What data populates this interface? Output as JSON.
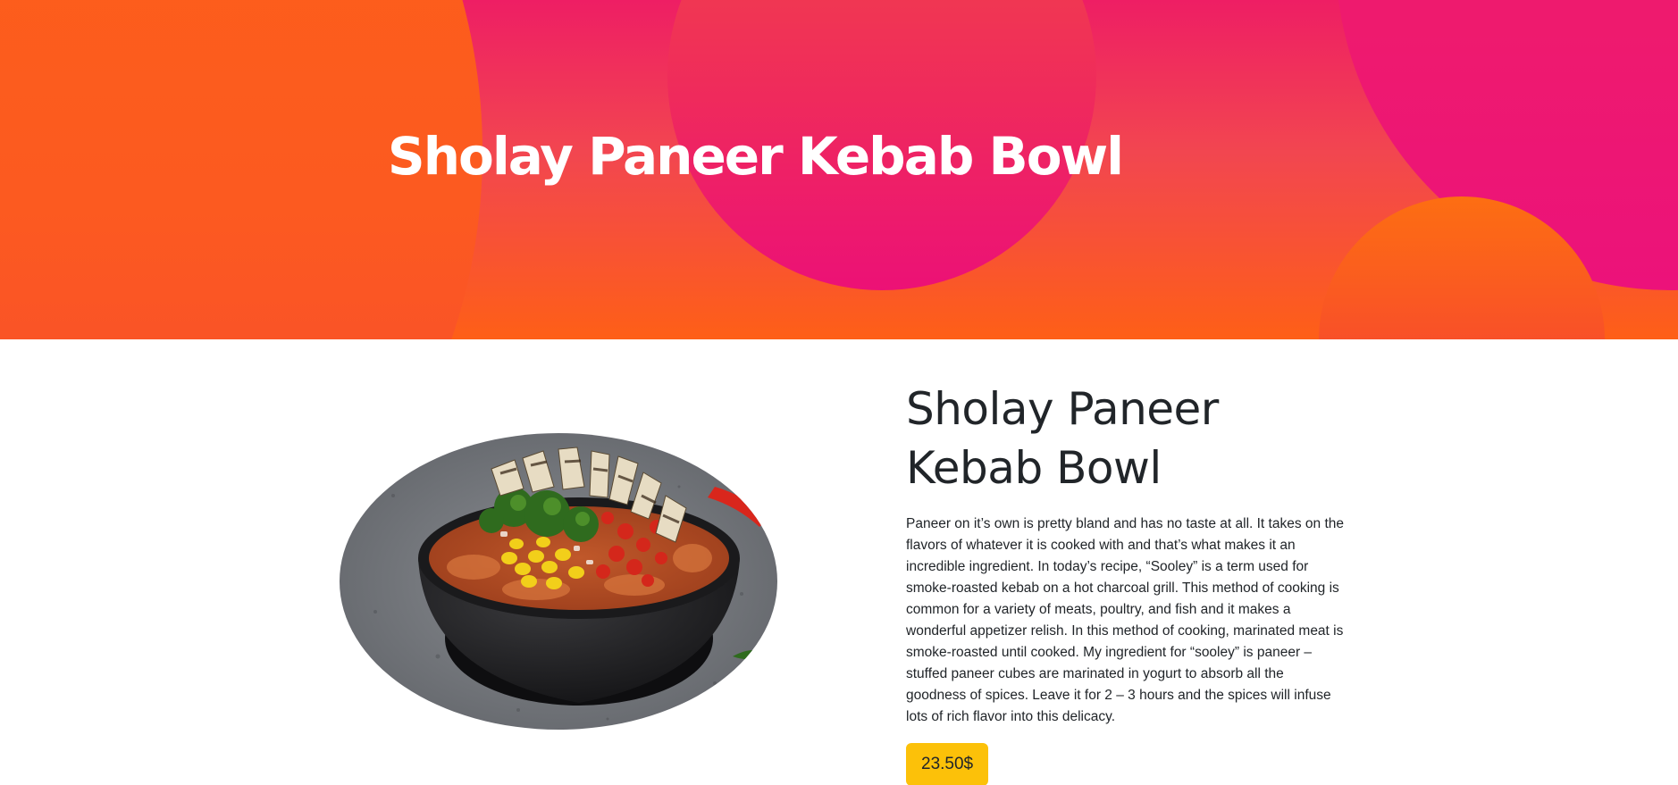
{
  "hero": {
    "title": "Sholay Paneer Kebab Bowl"
  },
  "recipe": {
    "title": "Sholay Paneer Kebab Bowl",
    "description": "Paneer on it’s own is pretty bland and has no taste at all. It takes on the flavors of whatever it is cooked with and that’s what makes it an incredible ingredient. In today’s recipe, “Sooley” is a term used for smoke-roasted kebab on a hot charcoal grill. This method of cooking is common for a variety of meats, poultry, and fish and it makes a wonderful appetizer relish. In this method of cooking, marinated meat is smoke-roasted until cooked. My ingredient for “sooley” is paneer – stuffed paneer cubes are marinated in yogurt to absorb all the goodness of spices. Leave it for 2 – 3 hours and the spices will infuse lots of rich flavor into this delicacy.",
    "price": "23.50$",
    "image_icon": "food-bowl-photo"
  },
  "colors": {
    "hero_orange": "#fe6215",
    "hero_pink": "#ec1176",
    "price_badge": "#fcc109",
    "text": "#212529"
  }
}
